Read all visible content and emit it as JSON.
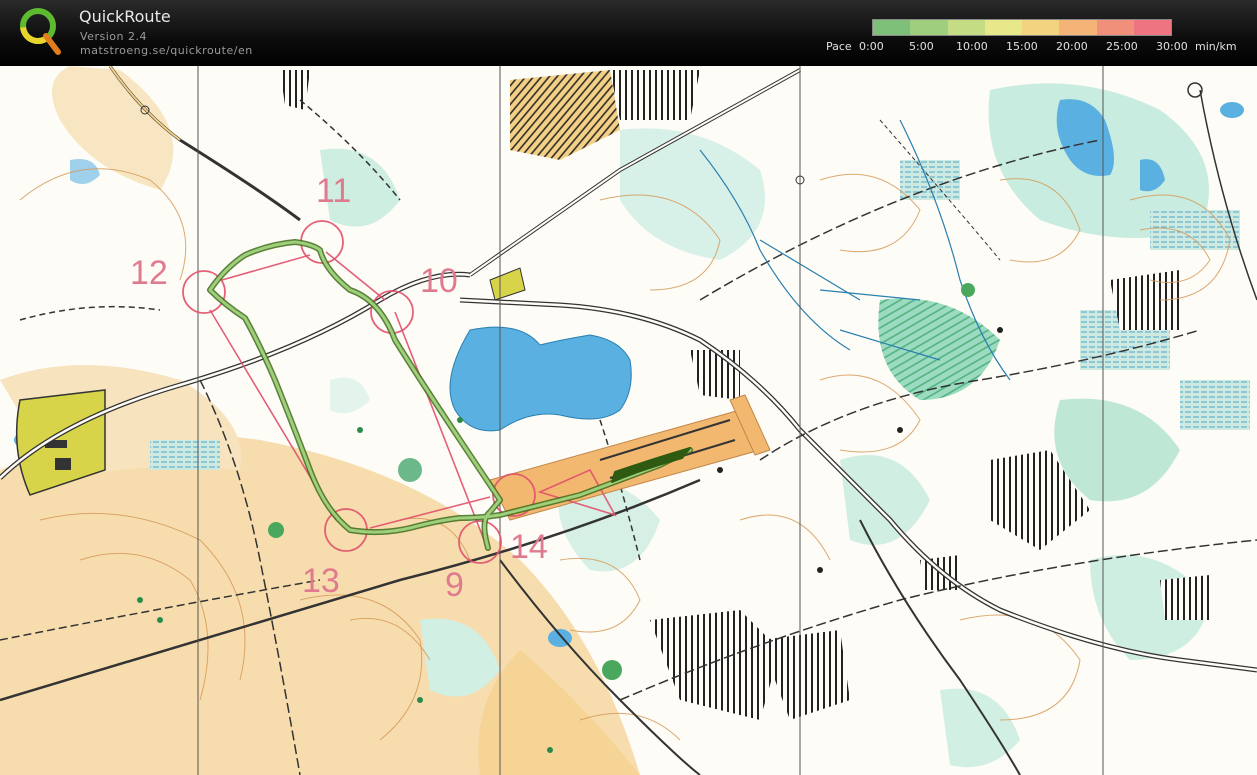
{
  "app": {
    "name": "QuickRoute",
    "version": "Version 2.4",
    "url": "matstroeng.se/quickroute/en"
  },
  "pace_legend": {
    "label": "Pace",
    "ticks": [
      "0:00",
      "5:00",
      "10:00",
      "15:00",
      "20:00",
      "25:00",
      "30:00"
    ],
    "unit": "min/km",
    "colors": [
      "#7ec07a",
      "#9fce7e",
      "#c4dd84",
      "#e6e88a",
      "#f3d47e",
      "#f4b377",
      "#f08f7a",
      "#ee7482"
    ]
  },
  "map": {
    "controls": [
      {
        "label": "9"
      },
      {
        "label": "10"
      },
      {
        "label": "11"
      },
      {
        "label": "12"
      },
      {
        "label": "13"
      },
      {
        "label": "14"
      }
    ],
    "colors": {
      "course": "#e0506c",
      "route": "#5a8a2a",
      "route_fast": "#3e6b1a",
      "water": "#5aa8d8",
      "marsh": "#58b0d0",
      "green": "#7fd0b4",
      "open": "#f4cf86",
      "yellow": "#d8d44a",
      "contour": "#d69a5a",
      "black": "#222222"
    }
  }
}
